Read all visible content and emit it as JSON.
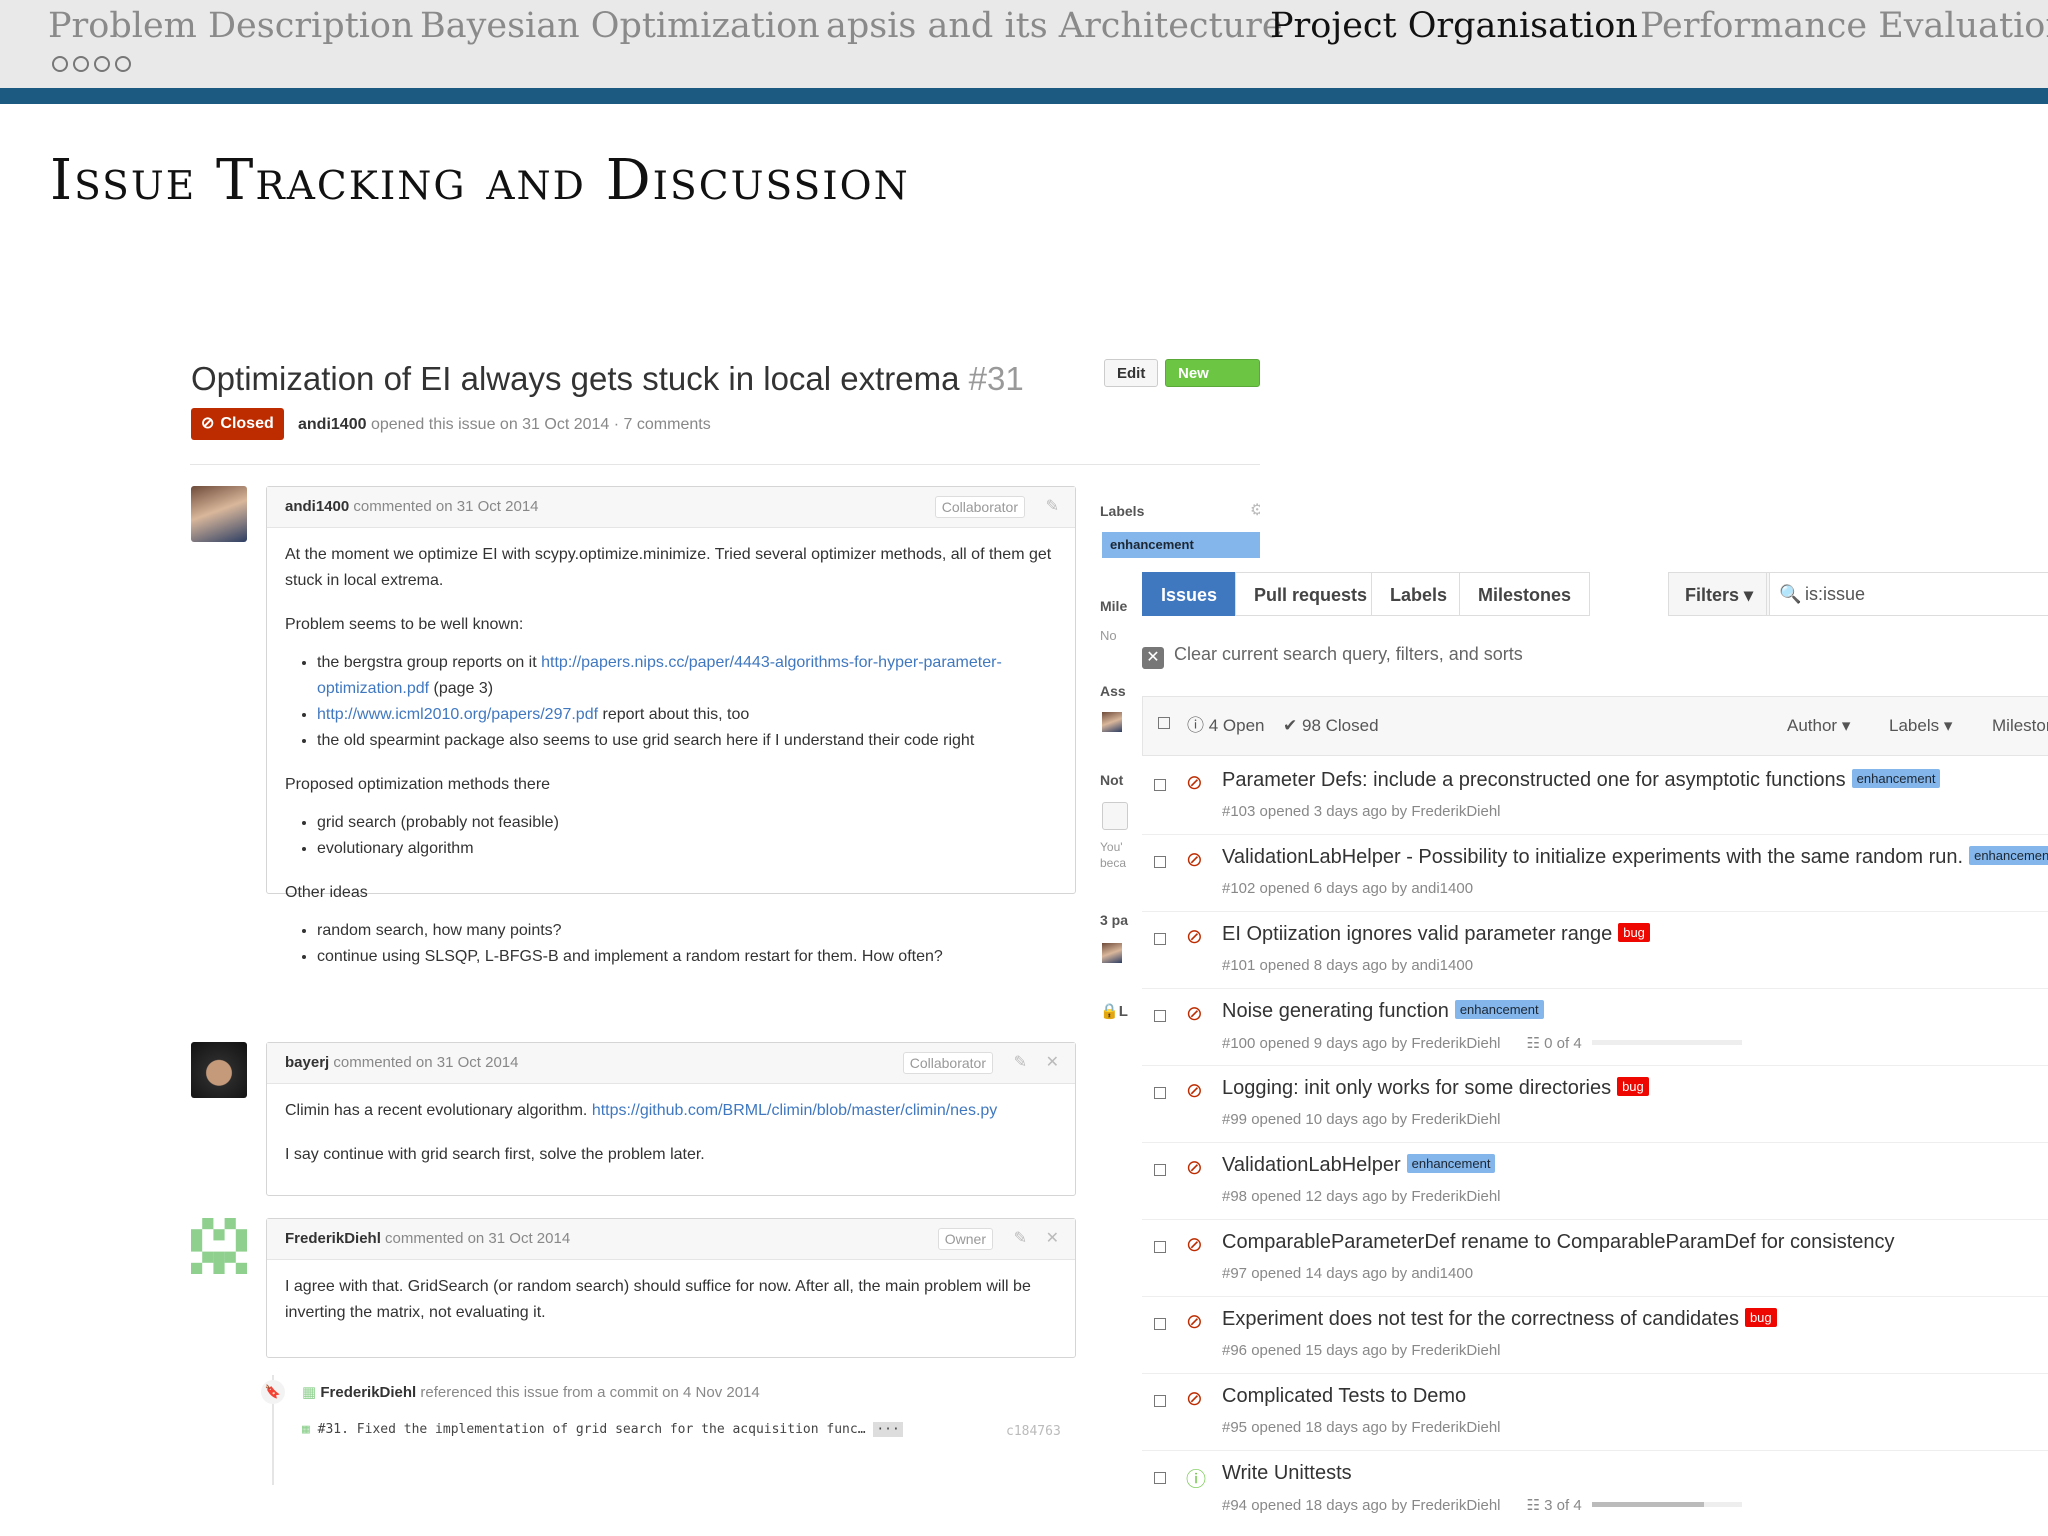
{
  "nav": {
    "sections": [
      "Problem Description",
      "Bayesian Optimization",
      "apsis and its Architecture",
      "Project Organisation",
      "Performance Evaluation"
    ],
    "active": "Project Organisation"
  },
  "slide": {
    "title": "Issue Tracking and Discussion"
  },
  "issue": {
    "title": "Optimization of EI always gets stuck in local extrema",
    "number": "#31",
    "edit_label": "Edit",
    "new_issue_label": "New issue",
    "state": "Closed",
    "author": "andi1400",
    "meta": "opened this issue on 31 Oct 2014 · 7 comments",
    "sidebar": {
      "labels_heading": "Labels",
      "label_enhancement": "enhancement",
      "milestone_heading": "Mile",
      "milestone_value": "No",
      "assignee_heading": "Ass",
      "notif_heading": "Not",
      "notif_text_1": "You'",
      "notif_text_2": "beca",
      "participants": "3 pa",
      "lock": "L"
    },
    "comments": [
      {
        "author": "andi1400",
        "meta": "commented on 31 Oct 2014",
        "role": "Collaborator",
        "p1": "At the moment we optimize EI with scypy.optimize.minimize. Tried several optimizer methods, all of them get stuck in local extrema.",
        "p2": "Problem seems to be well known:",
        "b1_pre": "the bergstra group reports on it ",
        "b1_link": "http://papers.nips.cc/paper/4443-algorithms-for-hyper-parameter-optimization.pdf",
        "b1_post": " (page 3)",
        "b2_link": "http://www.icml2010.org/papers/297.pdf",
        "b2_post": " report about this, too",
        "b3": "the old spearmint package also seems to use grid search here if I understand their code right",
        "p3": "Proposed optimization methods there",
        "b4": "grid search (probably not feasible)",
        "b5": "evolutionary algorithm",
        "p4": "Other ideas",
        "b6": "random search, how many points?",
        "b7": "continue using SLSQP, L-BFGS-B and implement a random restart for them. How often?"
      },
      {
        "author": "bayerj",
        "meta": "commented on 31 Oct 2014",
        "role": "Collaborator",
        "p1_pre": "Climin has a recent evolutionary algorithm. ",
        "p1_link": "https://github.com/BRML/climin/blob/master/climin/nes.py",
        "p2": "I say continue with grid search first, solve the problem later."
      },
      {
        "author": "FrederikDiehl",
        "meta": "commented on 31 Oct 2014",
        "role": "Owner",
        "p1": "I agree with that. GridSearch (or random search) should suffice for now. After all, the main problem will be inverting the matrix, not evaluating it."
      }
    ],
    "reference": {
      "author": "FrederikDiehl",
      "meta": "referenced this issue from a commit on 4 Nov 2014",
      "commit_msg": "#31. Fixed the implementation of grid search for the acquisition func…",
      "ellipsis": "···",
      "sha": "c184763"
    }
  },
  "list": {
    "tabs": [
      "Issues",
      "Pull requests",
      "Labels",
      "Milestones"
    ],
    "filters_label": "Filters",
    "search_value": "is:issue",
    "clear_text": "Clear current search query, filters, and sorts",
    "open_count": "4 Open",
    "closed_count": "98 Closed",
    "sort_author": "Author",
    "sort_labels": "Labels",
    "sort_milestones": "Milestones",
    "items": [
      {
        "title": "Parameter Defs: include a preconstructed one for asymptotic functions",
        "label": "enhancement",
        "sub": "#103 opened 3 days ago by FrederikDiehl"
      },
      {
        "title": "ValidationLabHelper - Possibility to initialize experiments with the same random run.",
        "label": "enhancement",
        "sub": "#102 opened 6 days ago by andi1400"
      },
      {
        "title": "EI Optiization ignores valid parameter range",
        "label": "bug",
        "sub": "#101 opened 8 days ago by andi1400"
      },
      {
        "title": "Noise generating function",
        "label": "enhancement",
        "sub": "#100 opened 9 days ago by FrederikDiehl",
        "tasks": "0 of 4",
        "progress": 0
      },
      {
        "title": "Logging: init only works for some directories",
        "label": "bug",
        "sub": "#99 opened 10 days ago by FrederikDiehl"
      },
      {
        "title": "ValidationLabHelper",
        "label": "enhancement",
        "sub": "#98 opened 12 days ago by FrederikDiehl"
      },
      {
        "title": "ComparableParameterDef rename to ComparableParamDef for consistency",
        "label": "",
        "sub": "#97 opened 14 days ago by andi1400"
      },
      {
        "title": "Experiment does not test for the correctness of candidates",
        "label": "bug",
        "sub": "#96 opened 15 days ago by FrederikDiehl"
      },
      {
        "title": "Complicated Tests to Demo",
        "label": "",
        "sub": "#95 opened 18 days ago by FrederikDiehl"
      },
      {
        "title": "Write Unittests",
        "label": "",
        "sub": "#94 opened 18 days ago by FrederikDiehl",
        "tasks": "3 of 4",
        "progress": 0.75,
        "open": true
      }
    ]
  },
  "colors": {
    "beamer_bar": "#1d5a82",
    "closed_red": "#bd2c00",
    "open_green": "#6cc644",
    "link_blue": "#4078c0",
    "label_enh": "#84b6eb",
    "label_bug": "#ee0701"
  }
}
